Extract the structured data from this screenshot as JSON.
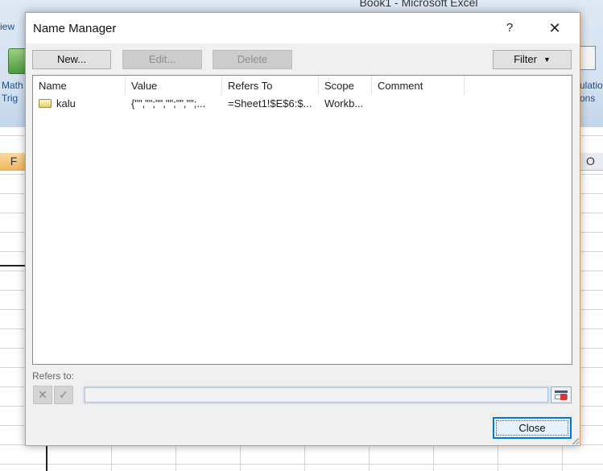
{
  "background": {
    "window_title": "Book1 - Microsoft Excel",
    "ribbon_tab": "iew",
    "left_group_label_1": "Math",
    "left_group_label_2": "Trig",
    "right_group_label_1": "ulatio",
    "right_group_label_2": "ons",
    "column_f": "F",
    "column_o": "O"
  },
  "dialog": {
    "title": "Name Manager",
    "help_label": "?",
    "close_icon": "close-icon",
    "buttons": {
      "new": "New...",
      "edit": "Edit...",
      "delete": "Delete",
      "filter": "Filter"
    },
    "table": {
      "columns": [
        "Name",
        "Value",
        "Refers To",
        "Scope",
        "Comment"
      ],
      "rows": [
        {
          "name": "kalu",
          "value": "{\"\",\"\";\"\",\"\";\"\",\"\";...",
          "refers_to": "=Sheet1!$E$6:$...",
          "scope": "Workb...",
          "comment": ""
        }
      ]
    },
    "refers_to_label": "Refers to:",
    "refers_to_value": "",
    "close_button": "Close"
  }
}
